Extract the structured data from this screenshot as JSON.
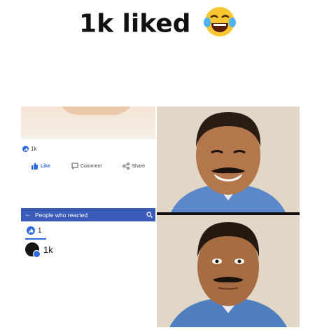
{
  "caption": {
    "text": "1k liked",
    "emoji": "face-with-tears-of-joy-icon"
  },
  "post": {
    "reaction_count": "1k",
    "actions": [
      {
        "label": "Like",
        "icon": "thumbs-up-icon"
      },
      {
        "label": "Comment",
        "icon": "comment-icon"
      },
      {
        "label": "Share",
        "icon": "share-icon"
      }
    ]
  },
  "reacted": {
    "title": "People who reacted",
    "tab_count": "1",
    "reactor_label": "1k"
  },
  "colors": {
    "facebook_blue": "#3b5bb8",
    "like_blue": "#2d6cdf"
  }
}
